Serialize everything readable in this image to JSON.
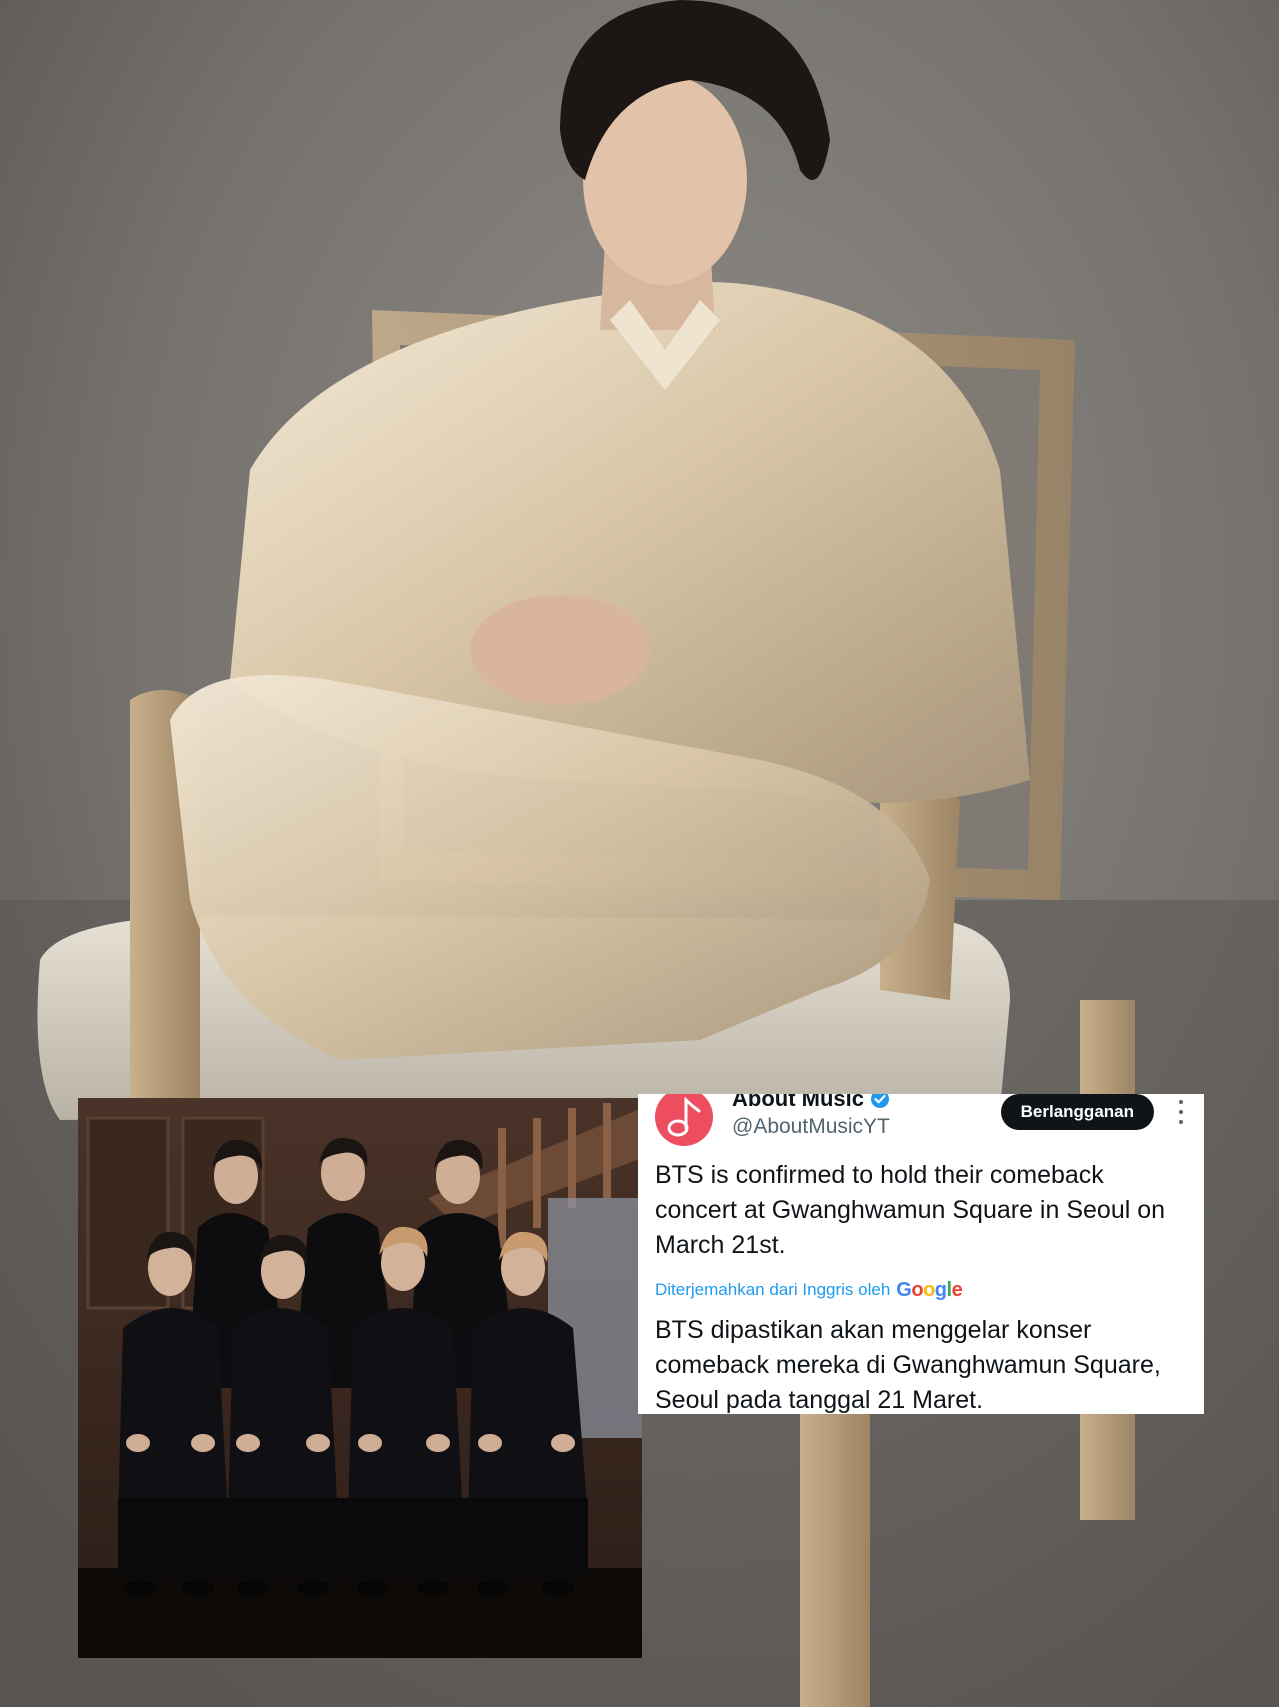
{
  "tweet": {
    "display_name": "About Music",
    "handle": "@AboutMusicYT",
    "subscribe_label": "Berlangganan",
    "original_text": "BTS is confirmed to hold their comeback concert at Gwanghwamun Square in Seoul on March 21st.",
    "translation_note": "Diterjemahkan dari Inggris oleh",
    "translation_provider": "Google",
    "translated_text": "BTS dipastikan akan menggelar konser comeback mereka di Gwanghwamun Square, Seoul pada tanggal 21 Maret.",
    "avatar_icon": "music-note-icon",
    "verified_icon": "verified-badge-icon",
    "more_icon": "more-vertical-icon"
  },
  "colors": {
    "avatar_bg": "#ec4d5f",
    "link_blue": "#1d9bf0",
    "button_bg": "#0f1419"
  }
}
